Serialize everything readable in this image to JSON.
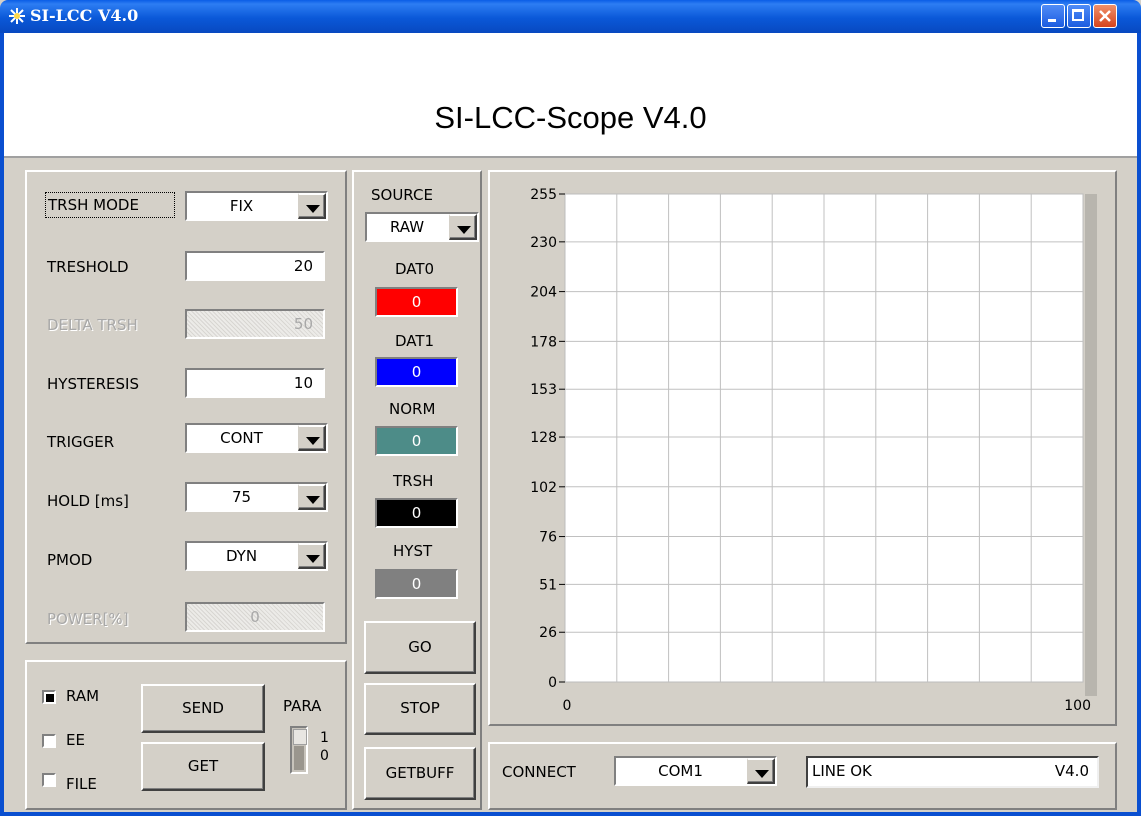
{
  "window": {
    "title": "SI-LCC V4.0"
  },
  "header": {
    "title": "SI-LCC-Scope V4.0"
  },
  "params": {
    "trsh_mode": {
      "label": "TRSH MODE",
      "value": "FIX"
    },
    "treshold": {
      "label": "TRESHOLD",
      "value": "20"
    },
    "delta_trsh": {
      "label": "DELTA TRSH",
      "value": "50"
    },
    "hysteresis": {
      "label": "HYSTERESIS",
      "value": "10"
    },
    "trigger": {
      "label": "TRIGGER",
      "value": "CONT"
    },
    "hold": {
      "label": "HOLD [ms]",
      "value": "75"
    },
    "pmod": {
      "label": "PMOD",
      "value": "DYN"
    },
    "power": {
      "label": "POWER[%]",
      "value": "0"
    }
  },
  "memory": {
    "ram_label": "RAM",
    "ee_label": "EE",
    "file_label": "FILE",
    "ram_checked": true,
    "ee_checked": false,
    "file_checked": false,
    "send_label": "SEND",
    "get_label": "GET",
    "para_label": "PARA",
    "para_one": "1",
    "para_zero": "0"
  },
  "indicators": {
    "source_label": "SOURCE",
    "source_value": "RAW",
    "dat0": {
      "label": "DAT0",
      "value": "0",
      "color": "#ff0000"
    },
    "dat1": {
      "label": "DAT1",
      "value": "0",
      "color": "#0000ff"
    },
    "norm": {
      "label": "NORM",
      "value": "0",
      "color": "#4d8c88"
    },
    "trsh": {
      "label": "TRSH",
      "value": "0",
      "color": "#000000"
    },
    "hyst": {
      "label": "HYST",
      "value": "0",
      "color": "#808080"
    }
  },
  "controls": {
    "go_label": "GO",
    "stop_label": "STOP",
    "getbuff_label": "GETBUFF"
  },
  "status": {
    "connect_label": "CONNECT",
    "port": "COM1",
    "line_status": "LINE OK",
    "version": "V4.0"
  },
  "chart_data": {
    "type": "line",
    "title": "",
    "xlabel": "",
    "ylabel": "",
    "xlim": [
      0,
      100
    ],
    "ylim": [
      0,
      255
    ],
    "x_ticks": [
      "0",
      "100"
    ],
    "y_ticks": [
      "0",
      "26",
      "51",
      "76",
      "102",
      "128",
      "153",
      "178",
      "204",
      "230",
      "255"
    ],
    "x_tick_values": [
      0,
      100
    ],
    "y_tick_values": [
      0,
      26,
      51,
      76,
      102,
      128,
      153,
      178,
      204,
      230,
      255
    ],
    "grid": true,
    "series": []
  }
}
